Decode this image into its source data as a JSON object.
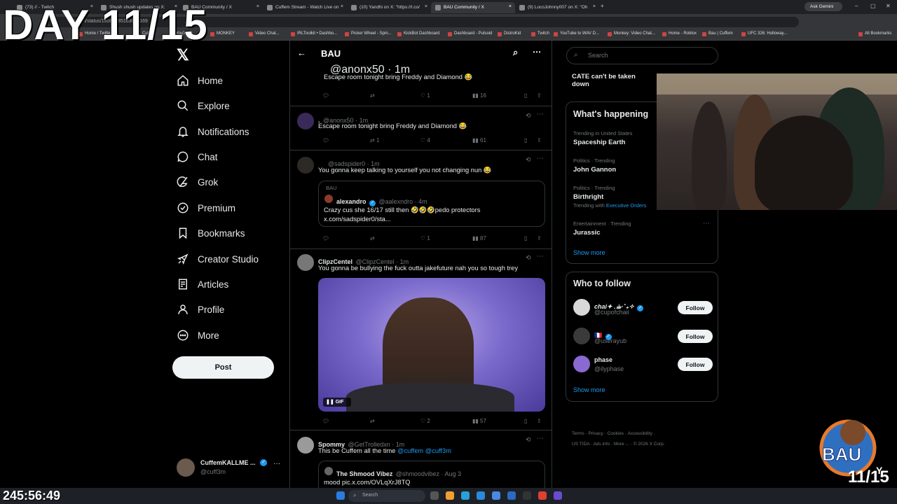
{
  "overlay": {
    "day_text": "DAY 11/15",
    "timer": "245:56:49",
    "corner_label": "11/15",
    "corner_y": "Y"
  },
  "browser": {
    "tabs": [
      {
        "title": "(73) // - Twitch",
        "active": false
      },
      {
        "title": "Shush shush updates on X:",
        "active": false
      },
      {
        "title": "BAU Community / X",
        "active": false
      },
      {
        "title": "Cuffem Stream - Watch Live on",
        "active": false
      },
      {
        "title": "(10) Yandhi on X: \"https://t.co/",
        "active": false
      },
      {
        "title": "BAU Community / X",
        "active": true
      },
      {
        "title": "(9) LocoJohnny007 on X: \"Oh",
        "active": false
      }
    ],
    "url": "x.com/i/status/19086785163002169",
    "ask_gemini": "Ask Gemini",
    "bookmarks": [
      "Home / Twitter",
      "Cuffem",
      "YouTube",
      "MONKEY",
      "Video Chat...",
      "IRLToolkit • Dashbo...",
      "Picker Wheel - Spin...",
      "KickBot Dashboard",
      "Dashboard - Pulsoid",
      "DistroKid",
      "Twitch",
      "YouTube to WAV D...",
      "Monkey: Video Chat...",
      "Home - Roblox",
      "Bau | Cuffem",
      "UFC 326: Holloway...",
      "All Bookmarks"
    ]
  },
  "nav": {
    "items": [
      {
        "label": "Home",
        "icon": "home-icon"
      },
      {
        "label": "Explore",
        "icon": "search-icon"
      },
      {
        "label": "Notifications",
        "icon": "bell-icon"
      },
      {
        "label": "Chat",
        "icon": "chat-icon"
      },
      {
        "label": "Grok",
        "icon": "grok-icon"
      },
      {
        "label": "Premium",
        "icon": "premium-icon"
      },
      {
        "label": "Bookmarks",
        "icon": "bookmark-icon"
      },
      {
        "label": "Creator Studio",
        "icon": "rocket-icon"
      },
      {
        "label": "Articles",
        "icon": "article-icon"
      },
      {
        "label": "Profile",
        "icon": "person-icon"
      },
      {
        "label": "More",
        "icon": "more-icon"
      }
    ],
    "post_label": "Post",
    "account": {
      "name": "CuffemKALLME ...",
      "handle": "@cuff3m"
    }
  },
  "feed": {
    "title": "BAU",
    "tweets": [
      {
        "name": "",
        "handle": "@anonx50 · 1m",
        "text": "Escape room tonight bring Freddy and Diamond 😂",
        "replies": "",
        "retweets": "",
        "likes": "1",
        "views": "16"
      },
      {
        "name": ".",
        "handle": "@anonx50 · 1m",
        "text": "Escape room tonight bring Freddy and Diamond 😂",
        "replies": "",
        "retweets": "1",
        "likes": "4",
        "views": "61"
      },
      {
        "name": "",
        "handle": "@sadspider0 · 1m",
        "text": "You gonna keep talking to yourself you not changing nun 😂",
        "replies": "",
        "retweets": "",
        "likes": "1",
        "views": "87",
        "quote": {
          "community": "BAU",
          "name": "alexandro",
          "handle": "@aalexndro · 4m",
          "text": "Crazy cus she 16/17 still then 🤣🤣🤣pedo protectors",
          "link": "x.com/sadspider0/sta..."
        }
      },
      {
        "name": "ClipzCentel",
        "handle": "@ClipzCentel · 1m",
        "text": "You gonna be bullying the fuck outta jakefuture nah you so tough trey",
        "media_badge": "GIF",
        "replies": "",
        "retweets": "",
        "likes": "2",
        "views": "57"
      },
      {
        "name": "Spommy",
        "handle": "@GetTrolledxn · 1m",
        "text_prefix": "This be Cuffem all the time ",
        "mention1": "@cuffem",
        "mention2": "@cuff3m",
        "quote": {
          "name": "The Shmood Vibez",
          "handle": "@shmoodvibez · Aug 3",
          "text": "mood pic.x.com/OVLqXrJ8TQ"
        }
      }
    ]
  },
  "right": {
    "search_placeholder": "Search",
    "banner_text": "CATE can't be taken down",
    "happening_title": "What's happening",
    "trends": [
      {
        "context": "Trending in United States",
        "name": "Spaceship Earth",
        "extra": ""
      },
      {
        "context": "Politics · Trending",
        "name": "John Gannon",
        "extra": ""
      },
      {
        "context": "Politics · Trending",
        "name": "Birthright",
        "extra_prefix": "Trending with ",
        "extra_link": "Executive Orders"
      },
      {
        "context": "Entertainment · Trending",
        "name": "Jurassic",
        "extra": ""
      }
    ],
    "show_more": "Show more",
    "follow_title": "Who to follow",
    "follows": [
      {
        "name": "chai✦ .☕︎·˚₊✧",
        "handle": "@cupofchaii",
        "button": "Follow"
      },
      {
        "name": "🇫🇷",
        "handle": "@userayub",
        "button": "Follow"
      },
      {
        "name": "phase",
        "handle": "@ilyphase",
        "button": "Follow"
      }
    ],
    "footer": [
      "Terms",
      "Privacy",
      "Cookies",
      "Accessibility",
      "US TIDA",
      "Ads info",
      "More ...",
      "© 2026 X Corp."
    ]
  },
  "taskbar": {
    "search_label": "Search"
  },
  "colors": {
    "accent": "#1d9bf0",
    "bg": "#000000",
    "border": "#2f3336"
  }
}
